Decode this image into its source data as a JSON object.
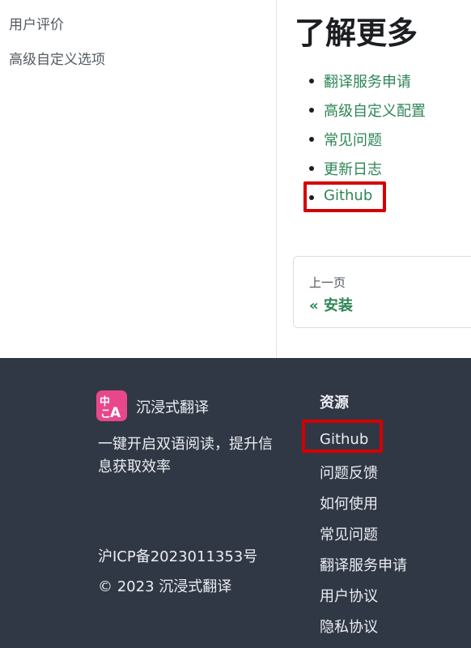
{
  "sidebar": {
    "items": [
      "用户评价",
      "高级自定义选项"
    ]
  },
  "content": {
    "title": "了解更多",
    "links": [
      "翻译服务申请",
      "高级自定义配置",
      "常见问题",
      "更新日志",
      "Github"
    ],
    "pager": {
      "sub_label": "上一页",
      "label": "« 安装"
    }
  },
  "footer": {
    "brand": {
      "logo_icon": "translate-logo-icon",
      "name": "沉浸式翻译"
    },
    "tagline": [
      "一键开启双语阅读，提升信",
      "息获取效率"
    ],
    "icp": "沪ICP备2023011353号",
    "copyright": "© 2023 沉浸式翻译",
    "resources": {
      "title": "资源",
      "links": [
        "Github",
        "问题反馈",
        "如何使用",
        "常见问题",
        "翻译服务申请",
        "用户协议",
        "隐私协议"
      ]
    }
  },
  "colors": {
    "link_green": "#2e8555",
    "footer_bg": "#303846",
    "highlight_red": "#d40000",
    "logo_pink": "#e8488b"
  }
}
